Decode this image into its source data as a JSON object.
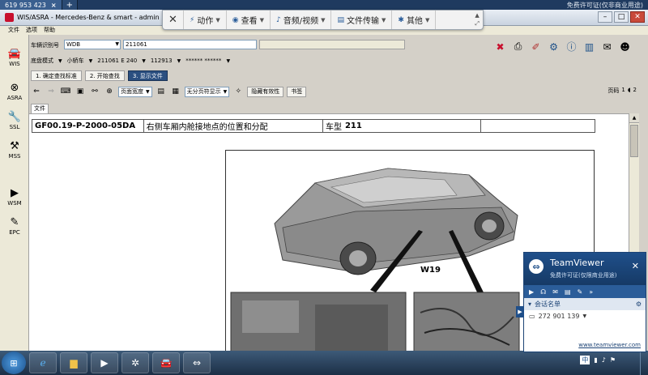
{
  "remote_tabs": [
    {
      "label": "619 953 423"
    },
    {
      "label": "+"
    }
  ],
  "remote_notice": "免费许可证(仅非商业用途)",
  "window": {
    "title": "WIS/ASRA - Mercedes-Benz & smart - admin"
  },
  "tv_toolbar": {
    "close": "✕",
    "items": [
      {
        "label": "动作"
      },
      {
        "label": "查看"
      },
      {
        "label": "音频/视频"
      },
      {
        "label": "文件传输"
      },
      {
        "label": "其他"
      }
    ]
  },
  "menu": [
    "文件",
    "选项",
    "帮助"
  ],
  "sidebar": [
    {
      "label": "WIS",
      "icon": "car-icon"
    },
    {
      "label": "ASRA",
      "icon": "gauge-icon"
    },
    {
      "label": "SSL",
      "icon": "wrench-icon"
    },
    {
      "label": "MSS",
      "icon": "tools-icon"
    },
    {
      "label": "WSM",
      "icon": "play-icon"
    },
    {
      "label": "EPC",
      "icon": "spark-icon"
    }
  ],
  "vehicle": {
    "vin_label": "车辆识别号",
    "vin_prefix": "WDB",
    "vin_value": "211061"
  },
  "row2": {
    "chassis_label": "底盘模式",
    "type": "小轿车",
    "model": "211061 E 240",
    "engine": "112913",
    "extra": "****** ******"
  },
  "steps": [
    {
      "label": "1. 确定查找标准",
      "active": false
    },
    {
      "label": "2. 开始查找",
      "active": false
    },
    {
      "label": "3. 显示文件",
      "active": true
    }
  ],
  "toolbar2": {
    "zoom": "页面宽度",
    "page_mode": "无分页符显示",
    "hide_validity": "隐藏有效性",
    "bookmark": "书签",
    "page_label": "页码",
    "page_current": "1",
    "page_total": "2"
  },
  "file_tab": "文件",
  "document": {
    "code": "GF00.19-P-2000-05DA",
    "title": "右侧车厢内舱接地点的位置和分配",
    "model_label": "车型",
    "model_value": "211",
    "callout": "W19"
  },
  "teamviewer": {
    "brand": "TeamViewer",
    "subtitle": "免费许可证(仅限商业用途)",
    "session_list": "会话名单",
    "partner_id": "272 901 139",
    "url": "www.teamviewer.com"
  },
  "taskbar": {
    "ime": "中"
  },
  "colors": {
    "accent": "#2b4f80",
    "tv_blue": "#1f4f8a",
    "brand_red": "#c8102e"
  }
}
